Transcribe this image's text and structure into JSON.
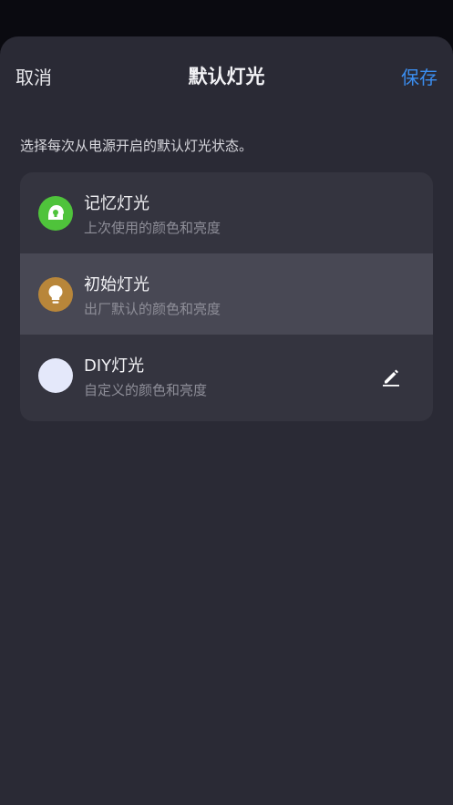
{
  "header": {
    "cancel_label": "取消",
    "title": "默认灯光",
    "save_label": "保存"
  },
  "description": "选择每次从电源开启的默认灯光状态。",
  "options": [
    {
      "name": "记忆灯光",
      "sub": "上次使用的颜色和亮度",
      "icon": "memory-light-icon",
      "icon_color": "#4fc33b",
      "selected": false
    },
    {
      "name": "初始灯光",
      "sub": "出厂默认的颜色和亮度",
      "icon": "bulb-icon",
      "icon_color": "#b8863a",
      "selected": true
    },
    {
      "name": "DIY灯光",
      "sub": "自定义的颜色和亮度",
      "icon": "diy-color-icon",
      "icon_color": "#e4e8fa",
      "selected": false,
      "action_icon": "edit-icon"
    }
  ],
  "colors": {
    "accent": "#3b8ef0",
    "sheet_background": "#2a2a35",
    "card_background": "#34343f",
    "selected_row": "#484854"
  }
}
